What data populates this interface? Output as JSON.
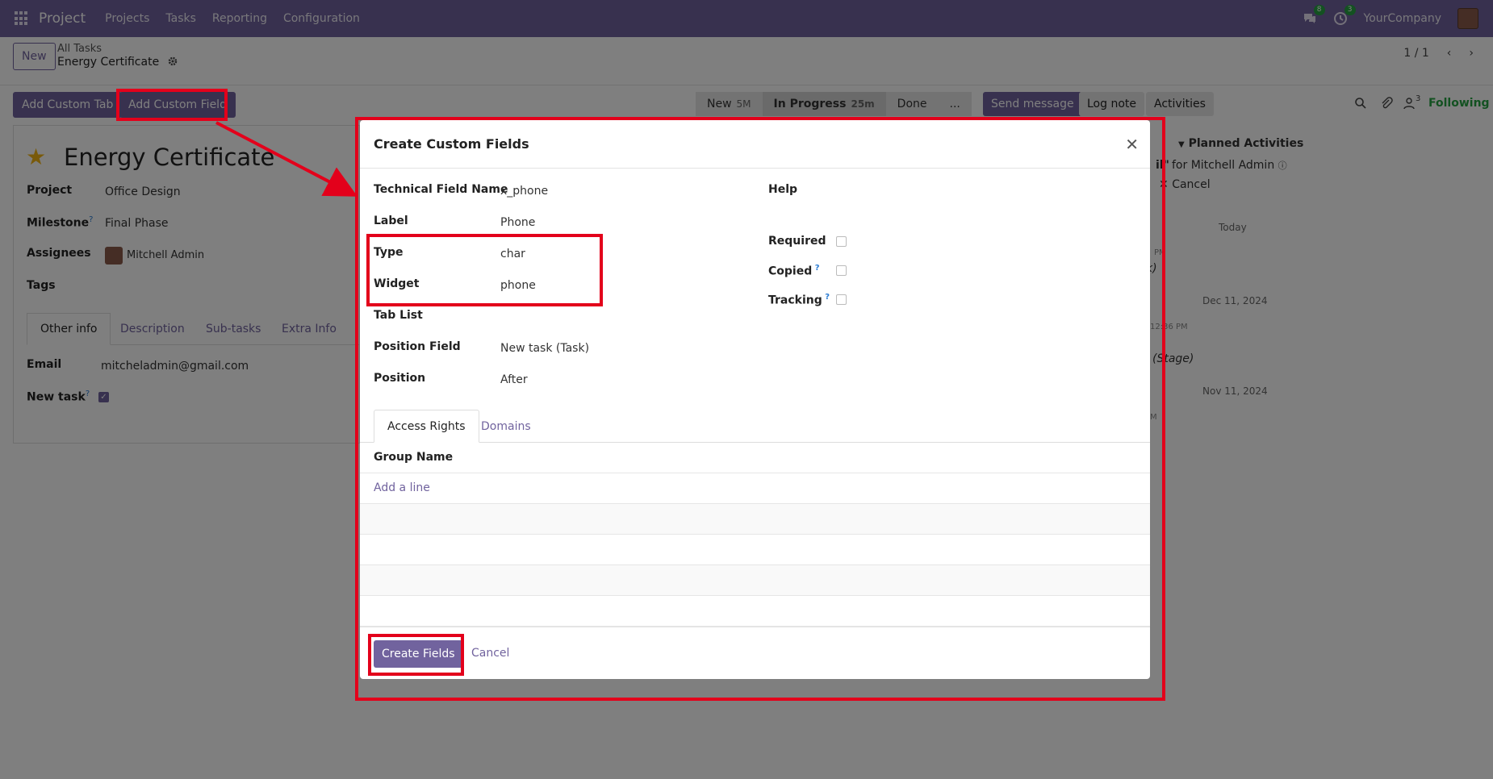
{
  "topnav": {
    "brand": "Project",
    "menu": [
      "Projects",
      "Tasks",
      "Reporting",
      "Configuration"
    ],
    "messages_badge": "8",
    "activities_badge": "3",
    "company": "YourCompany"
  },
  "control_panel": {
    "new_label": "New",
    "breadcrumb_parent": "All Tasks",
    "breadcrumb_current": "Energy Certificate",
    "pager": "1 / 1"
  },
  "actions": {
    "add_custom_tab": "Add Custom Tab",
    "add_custom_field": "Add Custom Field"
  },
  "statusbar": {
    "stages": [
      {
        "label": "New",
        "time": "5M"
      },
      {
        "label": "In Progress",
        "time": "25m"
      },
      {
        "label": "Done",
        "time": ""
      },
      {
        "label": "...",
        "time": ""
      }
    ]
  },
  "chatter": {
    "send_message": "Send message",
    "log_note": "Log note",
    "activities": "Activities",
    "followers_count": "3",
    "following": "Following",
    "planned_activities": "Planned Activities",
    "activity_for": "for Mitchell Admin",
    "activity_quote": "il\"",
    "cancel": "Cancel",
    "today": "Today",
    "date1": "Dec 11, 2024",
    "date2": "Nov 11, 2024",
    "stage_note": "(Stage)",
    "pm1": "PM",
    "time1": "12:36 PM",
    "paren": "k)",
    "m": "M"
  },
  "form": {
    "title": "Energy Certificate",
    "fields": [
      {
        "label": "Project",
        "value": "Office Design"
      },
      {
        "label": "Milestone",
        "value": "Final Phase"
      },
      {
        "label": "Assignees",
        "value": "Mitchell Admin"
      },
      {
        "label": "Tags",
        "value": ""
      }
    ],
    "tabs": [
      "Other info",
      "Description",
      "Sub-tasks",
      "Extra Info"
    ],
    "email_label": "Email",
    "email_value": "mitcheladmin@gmail.com",
    "new_task_label": "New task"
  },
  "modal": {
    "title": "Create Custom Fields",
    "left_fields": [
      {
        "label": "Technical Field Name",
        "value": "x_phone"
      },
      {
        "label": "Label",
        "value": "Phone"
      },
      {
        "label": "Type",
        "value": "char"
      },
      {
        "label": "Widget",
        "value": "phone"
      },
      {
        "label": "Tab List",
        "value": ""
      },
      {
        "label": "Position Field",
        "value": "New task (Task)"
      },
      {
        "label": "Position",
        "value": "After"
      }
    ],
    "help_label": "Help",
    "required_label": "Required",
    "copied_label": "Copied",
    "tracking_label": "Tracking",
    "tabs": [
      "Access Rights",
      "Domains"
    ],
    "group_name_header": "Group Name",
    "add_line": "Add a line",
    "create_button": "Create Fields",
    "cancel_button": "Cancel"
  },
  "colors": {
    "brand": "#71639e",
    "annotation": "#e3001b",
    "success": "#27a243"
  }
}
